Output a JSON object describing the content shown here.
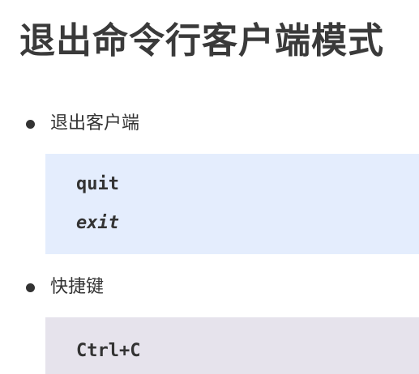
{
  "title": "退出命令行客户端模式",
  "sections": [
    {
      "label": "退出客户端",
      "code_lines": [
        "quit",
        "exit"
      ]
    },
    {
      "label": "快捷键",
      "code_lines": [
        "Ctrl+C"
      ]
    }
  ]
}
